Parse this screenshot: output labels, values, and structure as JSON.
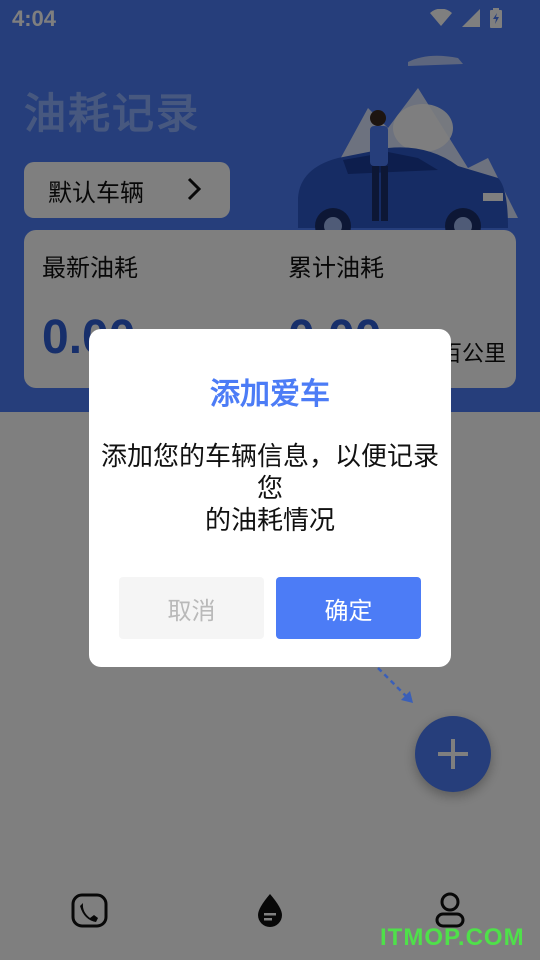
{
  "status_bar": {
    "time": "4:04"
  },
  "header": {
    "title": "油耗记录",
    "vehicle_button_label": "默认车辆"
  },
  "stats": {
    "latest_label": "最新油耗",
    "latest_value": "0.00",
    "total_label": "累计油耗",
    "total_value": "0.00",
    "unit": "百公里"
  },
  "bottom_nav": {
    "items": [
      {
        "icon": "phone-icon"
      },
      {
        "icon": "fuel-drop-icon"
      },
      {
        "icon": "profile-icon"
      }
    ]
  },
  "dialog": {
    "title": "添加爱车",
    "message_line1": "添加您的车辆信息，以便记录",
    "message_line2": "您",
    "message_line3": "的油耗情况",
    "cancel_label": "取消",
    "confirm_label": "确定"
  },
  "watermark": "ITMOP.COM",
  "colors": {
    "primary": "#4c7cf6",
    "value_blue": "#2e5fd6",
    "title_light": "#8fb1ff",
    "watermark_green": "#4fe04a"
  }
}
